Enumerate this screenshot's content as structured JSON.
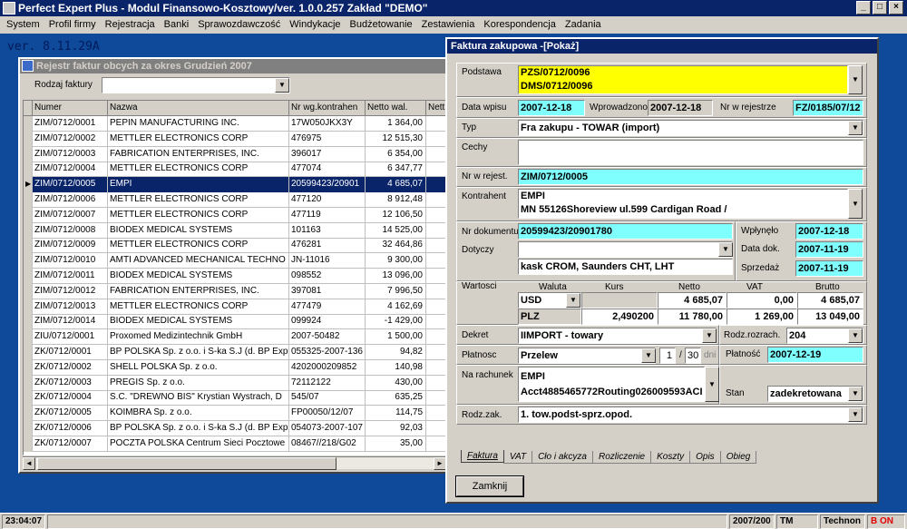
{
  "window": {
    "title": "Perfect Expert Plus - Modul Finansowo-Kosztowy/ver. 1.0.0.257 Zakład \"DEMO\""
  },
  "menu": [
    "System",
    "Profil firmy",
    "Rejestracja",
    "Banki",
    "Sprawozdawczość",
    "Windykacje",
    "Budżetowanie",
    "Zestawienia",
    "Korespondencja",
    "Zadania"
  ],
  "version": "ver. 8.11.29A",
  "register": {
    "title": "Rejestr faktur obcych za okres Grudzień 2007",
    "filter_label": "Rodzaj faktury",
    "filter_value": "",
    "columns": [
      "Numer",
      "Nazwa",
      "Nr wg.kontrahen",
      "Netto wal.",
      "Nett"
    ],
    "rows": [
      [
        "ZIM/0712/0001",
        "PEPIN MANUFACTURING INC.",
        "17W050JKX3Y",
        "1 364,00"
      ],
      [
        "ZIM/0712/0002",
        "METTLER ELECTRONICS CORP",
        "476975",
        "12 515,30"
      ],
      [
        "ZIM/0712/0003",
        "FABRICATION ENTERPRISES, INC.",
        "396017",
        "6 354,00"
      ],
      [
        "ZIM/0712/0004",
        "METTLER ELECTRONICS CORP",
        "477074",
        "6 347,77"
      ],
      [
        "ZIM/0712/0005",
        "EMPI",
        "20599423/20901",
        "4 685,07"
      ],
      [
        "ZIM/0712/0006",
        "METTLER ELECTRONICS CORP",
        "477120",
        "8 912,48"
      ],
      [
        "ZIM/0712/0007",
        "METTLER ELECTRONICS CORP",
        "477119",
        "12 106,50"
      ],
      [
        "ZIM/0712/0008",
        "BIODEX MEDICAL SYSTEMS",
        "101163",
        "14 525,00"
      ],
      [
        "ZIM/0712/0009",
        "METTLER ELECTRONICS CORP",
        "476281",
        "32 464,86"
      ],
      [
        "ZIM/0712/0010",
        "AMTI ADVANCED MECHANICAL TECHNO",
        "JN-11016",
        "9 300,00"
      ],
      [
        "ZIM/0712/0011",
        "BIODEX MEDICAL SYSTEMS",
        "098552",
        "13 096,00"
      ],
      [
        "ZIM/0712/0012",
        "FABRICATION ENTERPRISES, INC.",
        "397081",
        "7 996,50"
      ],
      [
        "ZIM/0712/0013",
        "METTLER ELECTRONICS CORP",
        "477479",
        "4 162,69"
      ],
      [
        "ZIM/0712/0014",
        "BIODEX MEDICAL SYSTEMS",
        "099924",
        "-1 429,00"
      ],
      [
        "ZIU/0712/0001",
        "Proxomed Medizintechnik GmbH",
        "2007-50482",
        "1 500,00"
      ],
      [
        "ZK/0712/0001",
        "BP POLSKA Sp. z o.o. i S-ka S.J (d. BP Exp",
        "055325-2007-136",
        "94,82"
      ],
      [
        "ZK/0712/0002",
        "SHELL POLSKA Sp. z o.o.",
        "4202000209852",
        "140,98"
      ],
      [
        "ZK/0712/0003",
        "PREGIS Sp. z o.o.",
        "72112122",
        "430,00"
      ],
      [
        "ZK/0712/0004",
        "S.C. \"DREWNO BIS\" Krystian Wystrach, D",
        "545/07",
        "635,25"
      ],
      [
        "ZK/0712/0005",
        "KOIMBRA Sp. z o.o.",
        "FP00050/12/07",
        "114,75"
      ],
      [
        "ZK/0712/0006",
        "BP POLSKA Sp. z o.o. i S-ka S.J (d. BP Exp",
        "054073-2007-107",
        "92,03"
      ],
      [
        "ZK/0712/0007",
        "POCZTA POLSKA Centrum Sieci Pocztowe",
        "08467//218/G02",
        "35,00"
      ]
    ],
    "selected_index": 4
  },
  "invoice": {
    "title": "Faktura zakupowa -[Pokaż]",
    "podstawa_label": "Podstawa",
    "podstawa_1": "PZS/0712/0096",
    "podstawa_2": "DMS/0712/0096",
    "data_wpisu_label": "Data wpisu",
    "data_wpisu": "2007-12-18",
    "wprowadzono_label": "Wprowadzono",
    "wprowadzono": "2007-12-18",
    "nr_rej_label": "Nr w rejestrze",
    "nr_rej": "FZ/0185/07/12",
    "typ_label": "Typ",
    "typ": "Fra zakupu - TOWAR (import)",
    "cechy_label": "Cechy",
    "nr_w_rejest_label": "Nr w rejest.",
    "nr_w_rejest": "ZIM/0712/0005",
    "kontrahent_label": "Kontrahent",
    "kontrahent_1": "EMPI",
    "kontrahent_2": "MN 55126Shoreview ul.599 Cardigan Road /",
    "nr_dok_label": "Nr dokumentu",
    "nr_dok": "20599423/20901780",
    "wplynelo_label": "Wpłynęło",
    "wplynelo": "2007-12-18",
    "dotyczy_label": "Dotyczy",
    "dotyczy": "kask CROM, Saunders CHT, LHT",
    "data_dok_label": "Data dok.",
    "data_dok": "2007-11-19",
    "sprzedaz_label": "Sprzedaż",
    "sprzedaz": "2007-11-19",
    "wartosci_label": "Wartosci",
    "val_headers": [
      "Waluta",
      "Kurs",
      "Netto",
      "VAT",
      "Brutto"
    ],
    "val_rows": [
      [
        "USD",
        "",
        "4 685,07",
        "0,00",
        "4 685,07"
      ],
      [
        "PLZ",
        "2,490200",
        "11 780,00",
        "1 269,00",
        "13 049,00"
      ]
    ],
    "dekret_label": "Dekret",
    "dekret": "IIMPORT - towary",
    "rodz_rozrach_label": "Rodz.rozrach.",
    "rodz_rozrach": "204",
    "platnosc_label": "Płatnosc",
    "platnosc": "Przelew",
    "platnosc_n": "1",
    "platnosc_sep": "/",
    "platnosc_days": "30",
    "platnosc_unit": "dni",
    "platnosc_date_label": "Płatność",
    "platnosc_date": "2007-12-19",
    "rachunek_label": "Na rachunek",
    "rachunek_1": "EMPI",
    "rachunek_2": "Acct4885465772Routing026009593ACI",
    "stan_label": "Stan",
    "stan": "zadekretowana",
    "rodz_zak_label": "Rodz.zak.",
    "rodz_zak": "1. tow.podst-sprz.opod.",
    "tabs": [
      "Faktura",
      "VAT",
      "Cło i akcyza",
      "Rozliczenie",
      "Koszty",
      "Opis",
      "Obieg"
    ],
    "close_button": "Zamknij"
  },
  "statusbar": {
    "time": "23:04:07",
    "period": "2007/200",
    "tm": "TM",
    "user": "Technon",
    "mode": "B ON"
  }
}
